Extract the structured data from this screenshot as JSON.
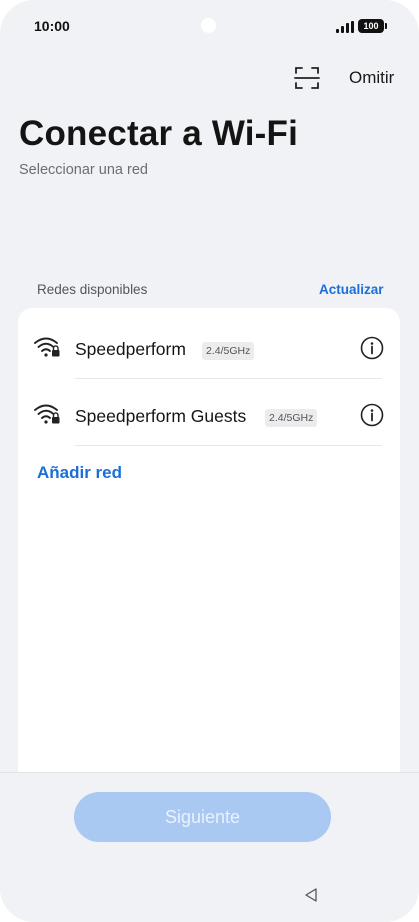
{
  "status_bar": {
    "time": "10:00",
    "battery": "100"
  },
  "header": {
    "skip_label": "Omitir"
  },
  "title": "Conectar a Wi-Fi",
  "subtitle": "Seleccionar una red",
  "networks_section": {
    "label": "Redes disponibles",
    "refresh_label": "Actualizar",
    "networks": [
      {
        "name": "Speedperform",
        "band": "2.4/5GHz",
        "secured": true
      },
      {
        "name": "Speedperform Guests",
        "band": "2.4/5GHz",
        "secured": true
      }
    ],
    "add_network_label": "Añadir red"
  },
  "footer": {
    "next_label": "Siguiente",
    "next_enabled": false
  },
  "icons": {
    "scan": "scan-icon",
    "wifi": "wifi-lock-icon",
    "info": "info-icon",
    "back": "nav-back-icon"
  },
  "colors": {
    "accent": "#1b6fd6",
    "button_disabled": "#a9c9f3",
    "background": "#f1f2f5",
    "card": "#ffffff"
  }
}
